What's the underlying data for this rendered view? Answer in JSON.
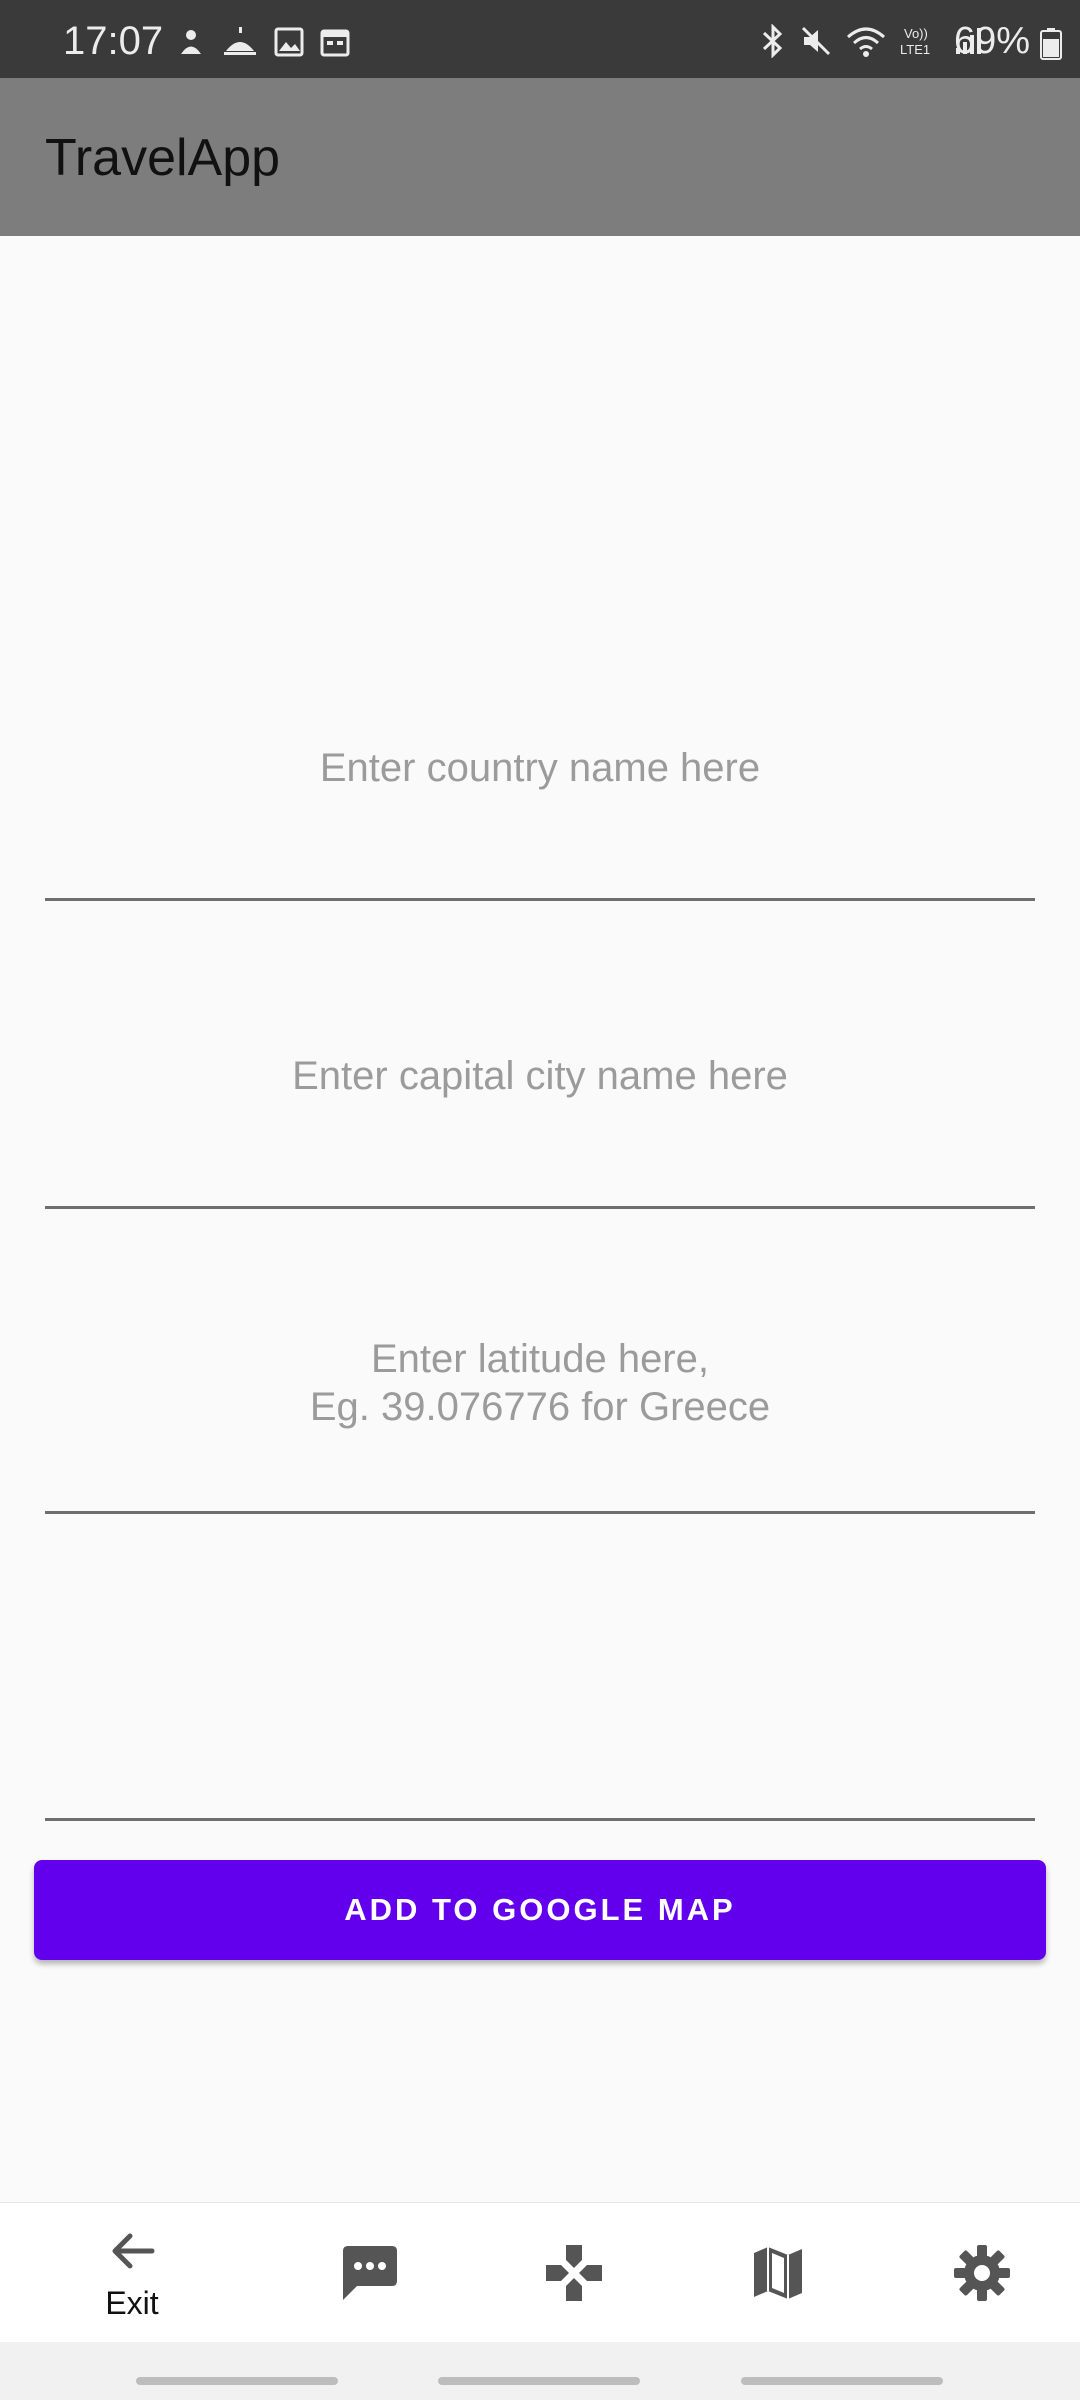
{
  "status_bar": {
    "time": "17:07",
    "battery": "69%",
    "left_icons": [
      "notification-icon",
      "weather-icon",
      "gallery-icon",
      "calendar-icon"
    ],
    "right_icons": [
      "bluetooth-icon",
      "mute-icon",
      "wifi-icon",
      "volte-icon",
      "signal-icon"
    ]
  },
  "app_bar": {
    "title": "TravelApp"
  },
  "form": {
    "country_placeholder": "Enter country name here",
    "capital_placeholder": "Enter capital city name here",
    "latitude_placeholder": "Enter latitude here,\nEg. 39.076776 for Greece",
    "longitude_placeholder": "",
    "add_button_label": "ADD TO GOOGLE MAP"
  },
  "bottom_nav": {
    "items": [
      {
        "label": "Exit",
        "icon": "arrow-back-icon"
      },
      {
        "label": "",
        "icon": "chat-icon"
      },
      {
        "label": "",
        "icon": "gamepad-icon"
      },
      {
        "label": "",
        "icon": "map-icon"
      },
      {
        "label": "",
        "icon": "settings-icon"
      }
    ]
  },
  "colors": {
    "accent": "#6200ee",
    "app_bar": "#7d7d7d",
    "status_bar": "#3a3a3a",
    "placeholder": "#9b9b9b"
  }
}
